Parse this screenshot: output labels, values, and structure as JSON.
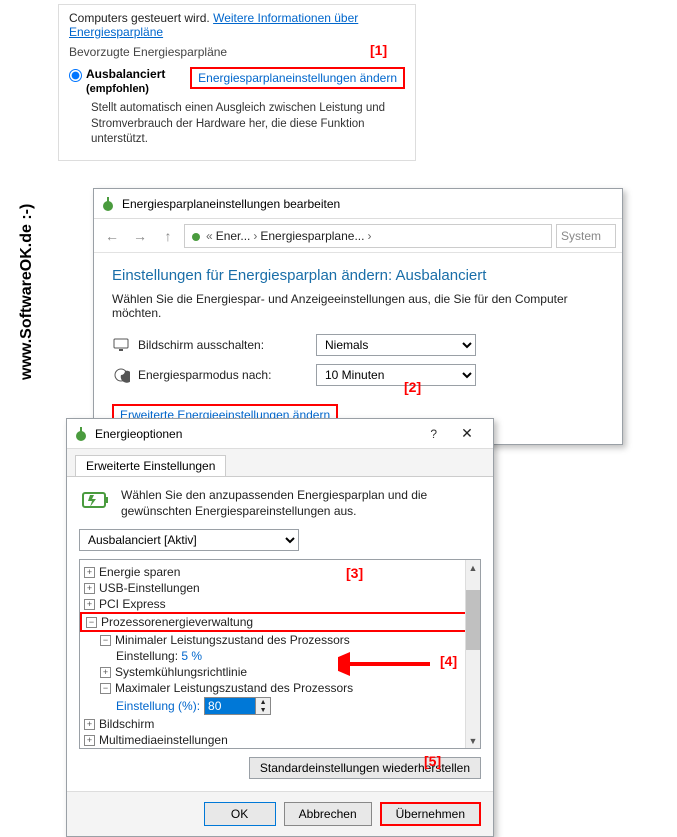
{
  "side_watermark": "www.SoftwareOK.de :-)",
  "marks": {
    "m1": "[1]",
    "m2": "[2]",
    "m3": "[3]",
    "m4": "[4]",
    "m5": "[5]"
  },
  "panel1": {
    "preline": "Computers gesteuert wird.",
    "more_info_link": "Weitere Informationen über Energiesparpläne",
    "group_label": "Bevorzugte Energiesparpläne",
    "plan_name": "Ausbalanciert",
    "plan_sub": "(empfohlen)",
    "change_link": "Energiesparplaneinstellungen ändern",
    "desc": "Stellt automatisch einen Ausgleich zwischen Leistung und Stromverbrauch der Hardware her, die diese Funktion unterstützt."
  },
  "win2": {
    "title": "Energiesparplaneinstellungen bearbeiten",
    "bc1": "Ener...",
    "bc2": "Energiesparplane...",
    "search_ph": "System",
    "heading": "Einstellungen für Energiesparplan ändern: Ausbalanciert",
    "instr": "Wählen Sie die Energiespar- und Anzeigeeinstellungen aus, die Sie für den Computer möchten.",
    "row1_label": "Bildschirm ausschalten:",
    "row1_value": "Niemals",
    "row2_label": "Energiesparmodus nach:",
    "row2_value": "10 Minuten",
    "adv_link": "Erweiterte Energieeinstellungen ändern"
  },
  "win3": {
    "title": "Energieoptionen",
    "tab": "Erweiterte Einstellungen",
    "intro": "Wählen Sie den anzupassenden Energiesparplan und die gewünschten Energiespareinstellungen aus.",
    "plan_option": "Ausbalanciert [Aktiv]",
    "tree": {
      "energy_save": "Energie sparen",
      "usb": "USB-Einstellungen",
      "pci": "PCI Express",
      "proc_mgmt": "Prozessorenergieverwaltung",
      "min_proc": "Minimaler Leistungszustand des Prozessors",
      "setting_label": "Einstellung:",
      "min_val": "5 %",
      "cooling": "Systemkühlungsrichtlinie",
      "max_proc": "Maximaler Leistungszustand des Prozessors",
      "setting_pct": "Einstellung (%):",
      "max_val": "80",
      "display": "Bildschirm",
      "multimedia": "Multimediaeinstellungen"
    },
    "restore_btn": "Standardeinstellungen wiederherstellen",
    "ok": "OK",
    "cancel": "Abbrechen",
    "apply": "Übernehmen"
  }
}
